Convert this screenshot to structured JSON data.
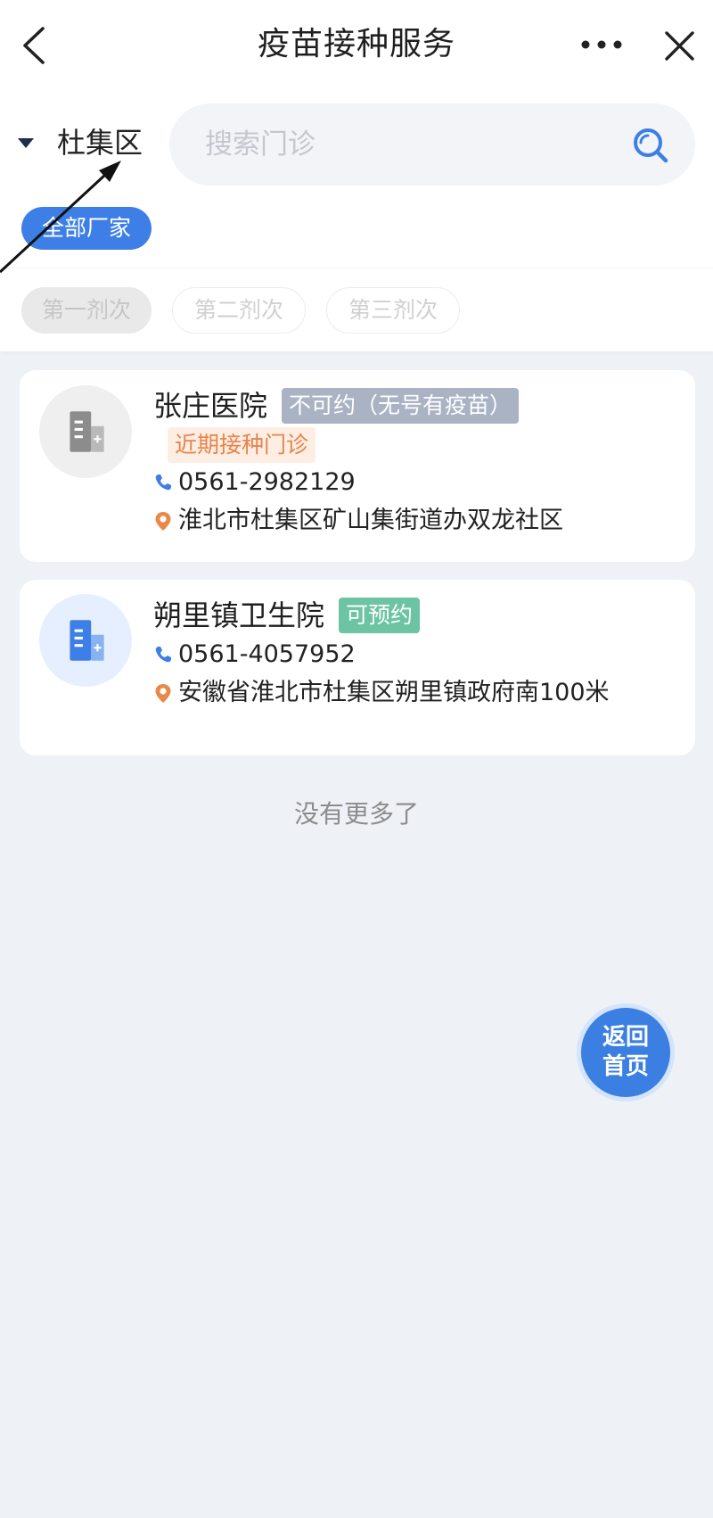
{
  "nav": {
    "title": "疫苗接种服务"
  },
  "filter": {
    "district": "杜集区",
    "search_placeholder": "搜索门诊"
  },
  "manufacturer_filter": {
    "label": "全部厂家"
  },
  "dose_tabs": [
    {
      "label": "第一剂次",
      "selected": true
    },
    {
      "label": "第二剂次",
      "selected": false
    },
    {
      "label": "第三剂次",
      "selected": false
    }
  ],
  "clinics": [
    {
      "name": "张庄医院",
      "avatar": {
        "icon": "hospital-building-icon",
        "bg": "#efefef",
        "color": "#8c8c8c"
      },
      "tags": [
        {
          "text": "不可约（无号有疫苗）",
          "bg": "#a9b3c4",
          "color": "#ffffff"
        },
        {
          "text": "近期接种门诊",
          "bg": "#fdeee4",
          "color": "#e8834a"
        }
      ],
      "phone": "0561-2982129",
      "address": "淮北市杜集区矿山集街道办双龙社区"
    },
    {
      "name": "朔里镇卫生院",
      "avatar": {
        "icon": "hospital-building-icon",
        "bg": "#e6efff",
        "color": "#3d7fe6"
      },
      "tags": [
        {
          "text": "可预约",
          "bg": "#6cc4a4",
          "color": "#ffffff"
        }
      ],
      "phone": "0561-4057952",
      "address": "安徽省淮北市杜集区朔里镇政府南100米"
    }
  ],
  "list_end_text": "没有更多了",
  "home_button": {
    "line1": "返回",
    "line2": "首页"
  },
  "colors": {
    "accent": "#3d7fe6",
    "page_bg": "#eef1f6",
    "phone_icon": "#3d7fe6",
    "location_icon": "#e8894a"
  }
}
